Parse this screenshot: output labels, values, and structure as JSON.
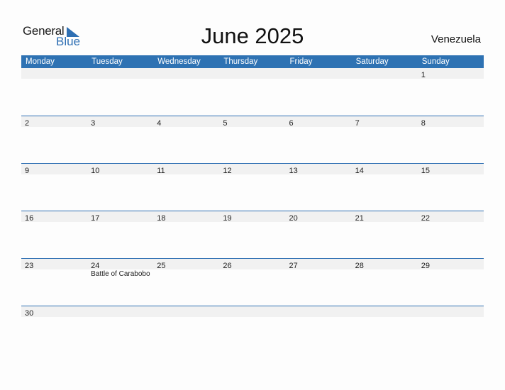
{
  "logo": {
    "word1": "General",
    "word2": "Blue"
  },
  "title": "June 2025",
  "country": "Venezuela",
  "colors": {
    "accent": "#2e72b3",
    "day_strip": "#f1f1f1"
  },
  "weekdays": [
    "Monday",
    "Tuesday",
    "Wednesday",
    "Thursday",
    "Friday",
    "Saturday",
    "Sunday"
  ],
  "weeks": [
    {
      "days": [
        "",
        "",
        "",
        "",
        "",
        "",
        "1"
      ],
      "events": [
        "",
        "",
        "",
        "",
        "",
        "",
        ""
      ]
    },
    {
      "days": [
        "2",
        "3",
        "4",
        "5",
        "6",
        "7",
        "8"
      ],
      "events": [
        "",
        "",
        "",
        "",
        "",
        "",
        ""
      ]
    },
    {
      "days": [
        "9",
        "10",
        "11",
        "12",
        "13",
        "14",
        "15"
      ],
      "events": [
        "",
        "",
        "",
        "",
        "",
        "",
        ""
      ]
    },
    {
      "days": [
        "16",
        "17",
        "18",
        "19",
        "20",
        "21",
        "22"
      ],
      "events": [
        "",
        "",
        "",
        "",
        "",
        "",
        ""
      ]
    },
    {
      "days": [
        "23",
        "24",
        "25",
        "26",
        "27",
        "28",
        "29"
      ],
      "events": [
        "",
        "Battle of Carabobo",
        "",
        "",
        "",
        "",
        ""
      ]
    },
    {
      "days": [
        "30",
        "",
        "",
        "",
        "",
        "",
        ""
      ],
      "events": [
        "",
        "",
        "",
        "",
        "",
        "",
        ""
      ]
    }
  ]
}
